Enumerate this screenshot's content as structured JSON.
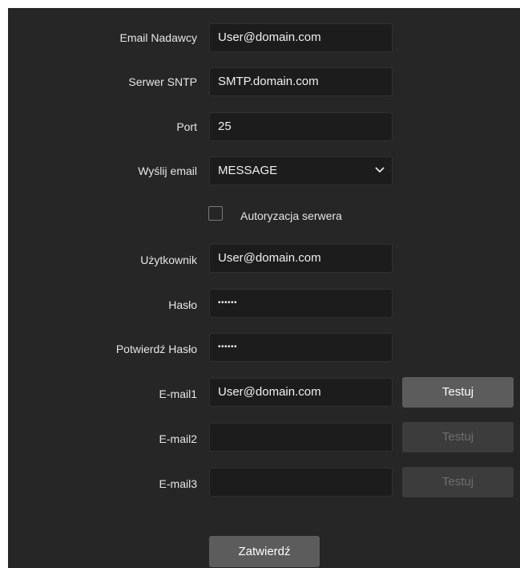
{
  "form": {
    "sender_email": {
      "label": "Email Nadawcy",
      "value": "User@domain.com"
    },
    "sntp_server": {
      "label": "Serwer SNTP",
      "value": "SMTP.domain.com"
    },
    "port": {
      "label": "Port",
      "value": "25"
    },
    "send_email": {
      "label": "Wyślij email",
      "value": "MESSAGE"
    },
    "server_auth": {
      "label": "Autoryzacja serwera",
      "checked": false
    },
    "user": {
      "label": "Użytkownik",
      "value": "User@domain.com"
    },
    "password": {
      "label": "Hasło",
      "value": "••••••"
    },
    "confirm_password": {
      "label": "Potwierdź Hasło",
      "value": "••••••"
    },
    "email1": {
      "label": "E-mail1",
      "value": "User@domain.com",
      "test_label": "Testuj"
    },
    "email2": {
      "label": "E-mail2",
      "value": "",
      "test_label": "Testuj"
    },
    "email3": {
      "label": "E-mail3",
      "value": "",
      "test_label": "Testuj"
    },
    "submit_label": "Zatwierdź"
  },
  "icons": {
    "dropdown": "chevron-down-icon"
  },
  "colors": {
    "background": "#262626",
    "field_background": "#1c1c1c",
    "button_active": "#5c5c5c",
    "button_disabled": "#3c3c3c"
  }
}
